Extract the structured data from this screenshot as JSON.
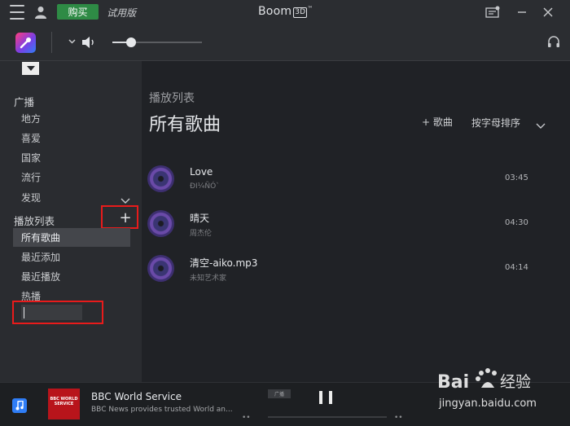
{
  "titlebar": {
    "buy_label": "购买",
    "trial_label": "试用版",
    "app_name": "Boom",
    "app_badge": "3D",
    "app_tm": "™"
  },
  "toolbar": {
    "volume_level": 0.21
  },
  "sidebar": {
    "radio_header": "广播",
    "radio_items": [
      "地方",
      "喜爱",
      "国家",
      "流行",
      "发现"
    ],
    "playlists_header": "播放列表",
    "playlist_items": [
      "所有歌曲",
      "最近添加",
      "最近播放",
      "热播"
    ],
    "selected_playlist": "所有歌曲",
    "new_playlist_value": ""
  },
  "main": {
    "section_label": "播放列表",
    "title": "所有歌曲",
    "add_song_label": "+ 歌曲",
    "sort_label": "按字母排序",
    "tracks": [
      {
        "title": "Love",
        "artist": "ÐI¼ÑÓ`",
        "duration": "03:45"
      },
      {
        "title": "晴天",
        "artist": "周杰伦",
        "duration": "04:30"
      },
      {
        "title": "清空-aiko.mp3",
        "artist": "未知艺术家",
        "duration": "04:14"
      }
    ]
  },
  "player": {
    "station_art_text": "BBC WORLD SERVICE",
    "station_title": "BBC World Service",
    "station_desc": "BBC News provides trusted World an...",
    "tag": "广播"
  },
  "watermark": {
    "text": "Bai 经验 jingyan.baidu.com"
  },
  "colors": {
    "buy_green": "#2e8b45",
    "highlight_red": "#e81b1b",
    "accent_blue": "#2f7df6"
  }
}
